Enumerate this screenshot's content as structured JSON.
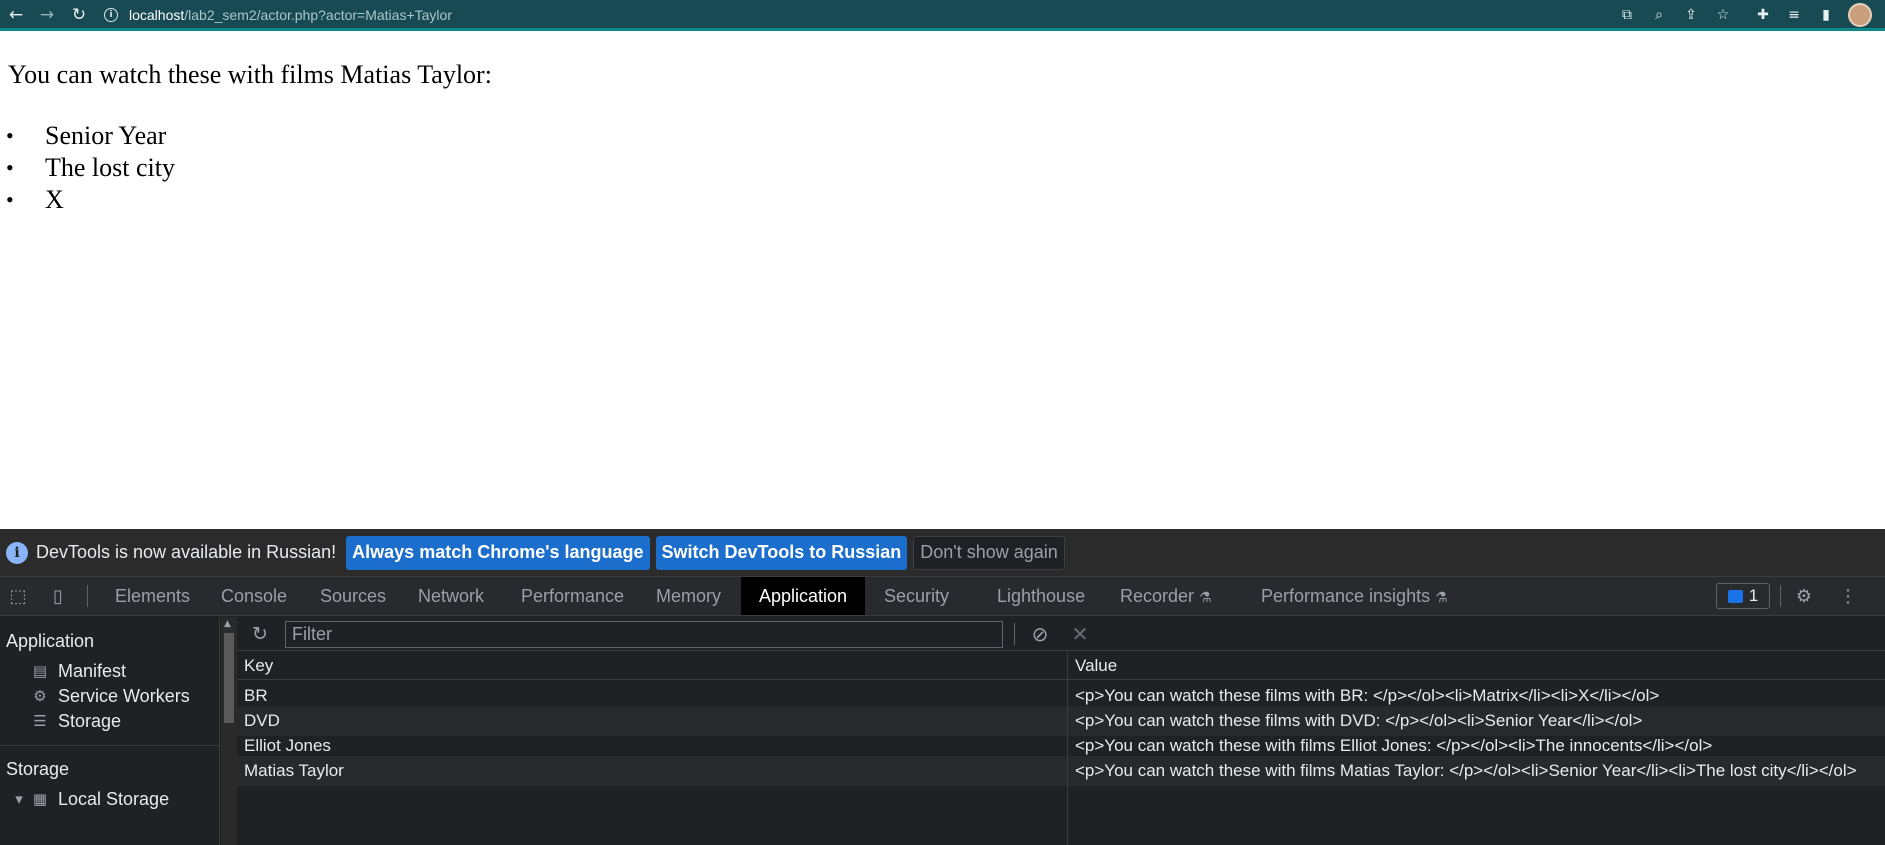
{
  "browser": {
    "url_host": "localhost",
    "url_path": "/lab2_sem2/actor.php?actor=Matias+Taylor"
  },
  "page": {
    "heading": "You can watch these with films Matias Taylor:",
    "films": [
      "Senior Year",
      "The lost city",
      "X"
    ],
    "bullet": "•"
  },
  "devtools": {
    "infobar": {
      "message": "DevTools is now available in Russian!",
      "buttons": [
        "Always match Chrome's language",
        "Switch DevTools to Russian",
        "Don't show again"
      ]
    },
    "tabs": [
      "Elements",
      "Console",
      "Sources",
      "Network",
      "Performance",
      "Memory",
      "Application",
      "Security",
      "Lighthouse",
      "Recorder",
      "Performance insights"
    ],
    "active_tab": "Application",
    "issues_count": "1",
    "sidebar": {
      "application_heading": "Application",
      "application_items": [
        {
          "label": "Manifest",
          "icon": "file-icon"
        },
        {
          "label": "Service Workers",
          "icon": "gear-icon"
        },
        {
          "label": "Storage",
          "icon": "database-icon"
        }
      ],
      "storage_heading": "Storage",
      "storage_items": [
        {
          "label": "Local Storage",
          "icon": "grid-icon"
        }
      ]
    },
    "filter": {
      "placeholder": "Filter"
    },
    "table": {
      "headers": {
        "key": "Key",
        "value": "Value"
      },
      "rows": [
        {
          "key": "BR",
          "value": "<p>You can watch these films with BR: </p></ol><li>Matrix</li><li>X</li></ol>"
        },
        {
          "key": "DVD",
          "value": "<p>You can watch these films with DVD: </p></ol><li>Senior Year</li></ol>"
        },
        {
          "key": "Elliot Jones",
          "value": "<p>You can watch these with films Elliot Jones: </p></ol><li>The innocents</li></ol>"
        },
        {
          "key": "Matias Taylor",
          "value": "<p>You can watch these with films Matias Taylor: </p></ol><li>Senior Year</li><li>The lost city</li></ol>"
        }
      ]
    },
    "colors": {
      "topbar": "#174a53",
      "active_tab": "#000000",
      "primary_button": "#1b6ecc",
      "panel_bg": "#202124"
    }
  }
}
